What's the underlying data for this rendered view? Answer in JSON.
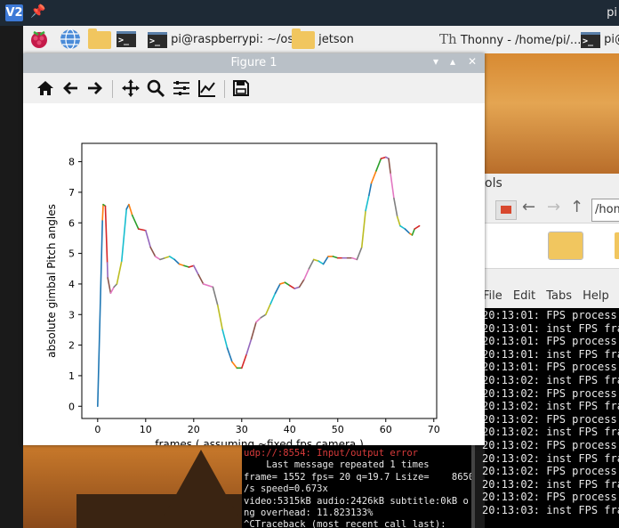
{
  "vnc": {
    "logo": "V2",
    "pin": "📌",
    "hostname": "pi"
  },
  "taskbar": {
    "terminal_task": "pi@raspberrypi: ~/os...",
    "folder_task": "jetson",
    "thonny_task": "Thonny  -  /home/pi/...",
    "terminal_task2": "pi@"
  },
  "figure": {
    "title": "Figure 1",
    "window_controls": [
      "▾",
      "▴",
      "✕"
    ],
    "toolbar_icons": [
      "home-icon",
      "back-icon",
      "forward-icon",
      "pan-icon",
      "zoom-icon",
      "configure-icon",
      "edit-axes-icon",
      "save-icon"
    ]
  },
  "file_manager": {
    "title_fragment": "ols",
    "path_fragment": "/hom"
  },
  "terminal_right": {
    "menu": [
      "File",
      "Edit",
      "Tabs",
      "Help"
    ],
    "lines": [
      "20:13:01: FPS process",
      "20:13:01: inst FPS fra",
      "20:13:01: FPS process",
      "20:13:01: inst FPS fra",
      "20:13:01: FPS process",
      "20:13:02: inst FPS fra",
      "20:13:02: FPS process",
      "20:13:02: inst FPS fra",
      "20:13:02: FPS process",
      "20:13:02: inst FPS fra",
      "20:13:02: FPS process",
      "20:13:02: inst FPS fra",
      "20:13:02: FPS process",
      "20:13:02: inst FPS fra",
      "20:13:02: FPS process",
      "20:13:03: inst FPS fra"
    ]
  },
  "terminal_left": {
    "error_line": "udp://:8554: Input/output error",
    "lines": [
      "    Last message repeated 1 times",
      "frame= 1552 fps= 20 q=19.7 Lsize=    8650",
      "/s speed=0.673x",
      "video:5315kB audio:2426kB subtitle:0kB o",
      "ng overhead: 11.823133%",
      "^CTraceback (most recent call last):"
    ]
  },
  "chart_data": {
    "type": "line",
    "xlabel": "frames ( assuming ~fixed fps camera )",
    "ylabel": "absolute gimbal Pitch angles",
    "xlim": [
      -3.3,
      70.6
    ],
    "ylim": [
      -0.4,
      8.6
    ],
    "xticks": [
      0,
      10,
      20,
      30,
      40,
      50,
      60,
      70
    ],
    "yticks": [
      0,
      1,
      2,
      3,
      4,
      5,
      6,
      7,
      8
    ],
    "grid": false,
    "series_colors": [
      "#1f77b4",
      "#ff7f0e",
      "#2ca02c",
      "#d62728",
      "#9467bd",
      "#8c564b",
      "#e377c2",
      "#7f7f7f",
      "#bcbd22",
      "#17becf"
    ],
    "points": [
      [
        0,
        0.0
      ],
      [
        1,
        6.1
      ],
      [
        1.15,
        6.6
      ],
      [
        1.6,
        6.55
      ],
      [
        2,
        4.7
      ],
      [
        2.1,
        4.2
      ],
      [
        2.7,
        3.7
      ],
      [
        3.4,
        3.9
      ],
      [
        4,
        4.0
      ],
      [
        5,
        4.75
      ],
      [
        6,
        6.45
      ],
      [
        6.5,
        6.6
      ],
      [
        7.2,
        6.25
      ],
      [
        8.5,
        5.8
      ],
      [
        10,
        5.75
      ],
      [
        11,
        5.2
      ],
      [
        12,
        4.9
      ],
      [
        13,
        4.8
      ],
      [
        14,
        4.85
      ],
      [
        15,
        4.9
      ],
      [
        16,
        4.8
      ],
      [
        17,
        4.65
      ],
      [
        18,
        4.6
      ],
      [
        19,
        4.55
      ],
      [
        20,
        4.6
      ],
      [
        21,
        4.3
      ],
      [
        22,
        4.0
      ],
      [
        24,
        3.9
      ],
      [
        25,
        3.3
      ],
      [
        26,
        2.5
      ],
      [
        27,
        1.9
      ],
      [
        28,
        1.45
      ],
      [
        29,
        1.25
      ],
      [
        30,
        1.25
      ],
      [
        31,
        1.7
      ],
      [
        32,
        2.2
      ],
      [
        33,
        2.75
      ],
      [
        34,
        2.9
      ],
      [
        35,
        3.0
      ],
      [
        36,
        3.35
      ],
      [
        37,
        3.7
      ],
      [
        38,
        4.0
      ],
      [
        39,
        4.05
      ],
      [
        40,
        3.95
      ],
      [
        41,
        3.85
      ],
      [
        42,
        3.9
      ],
      [
        43,
        4.15
      ],
      [
        44,
        4.5
      ],
      [
        45,
        4.8
      ],
      [
        46,
        4.75
      ],
      [
        47,
        4.65
      ],
      [
        48,
        4.9
      ],
      [
        49,
        4.9
      ],
      [
        50,
        4.85
      ],
      [
        51,
        4.85
      ],
      [
        52,
        4.85
      ],
      [
        53,
        4.85
      ],
      [
        54,
        4.8
      ],
      [
        55,
        5.2
      ],
      [
        55.8,
        6.4
      ],
      [
        56.5,
        6.9
      ],
      [
        57,
        7.3
      ],
      [
        58,
        7.7
      ],
      [
        59,
        8.1
      ],
      [
        60,
        8.15
      ],
      [
        60.6,
        8.1
      ],
      [
        61,
        7.6
      ],
      [
        61.7,
        6.8
      ],
      [
        62.4,
        6.2
      ],
      [
        63,
        5.9
      ],
      [
        64,
        5.8
      ],
      [
        65,
        5.65
      ],
      [
        65.5,
        5.6
      ],
      [
        66,
        5.8
      ],
      [
        67,
        5.9
      ]
    ]
  }
}
